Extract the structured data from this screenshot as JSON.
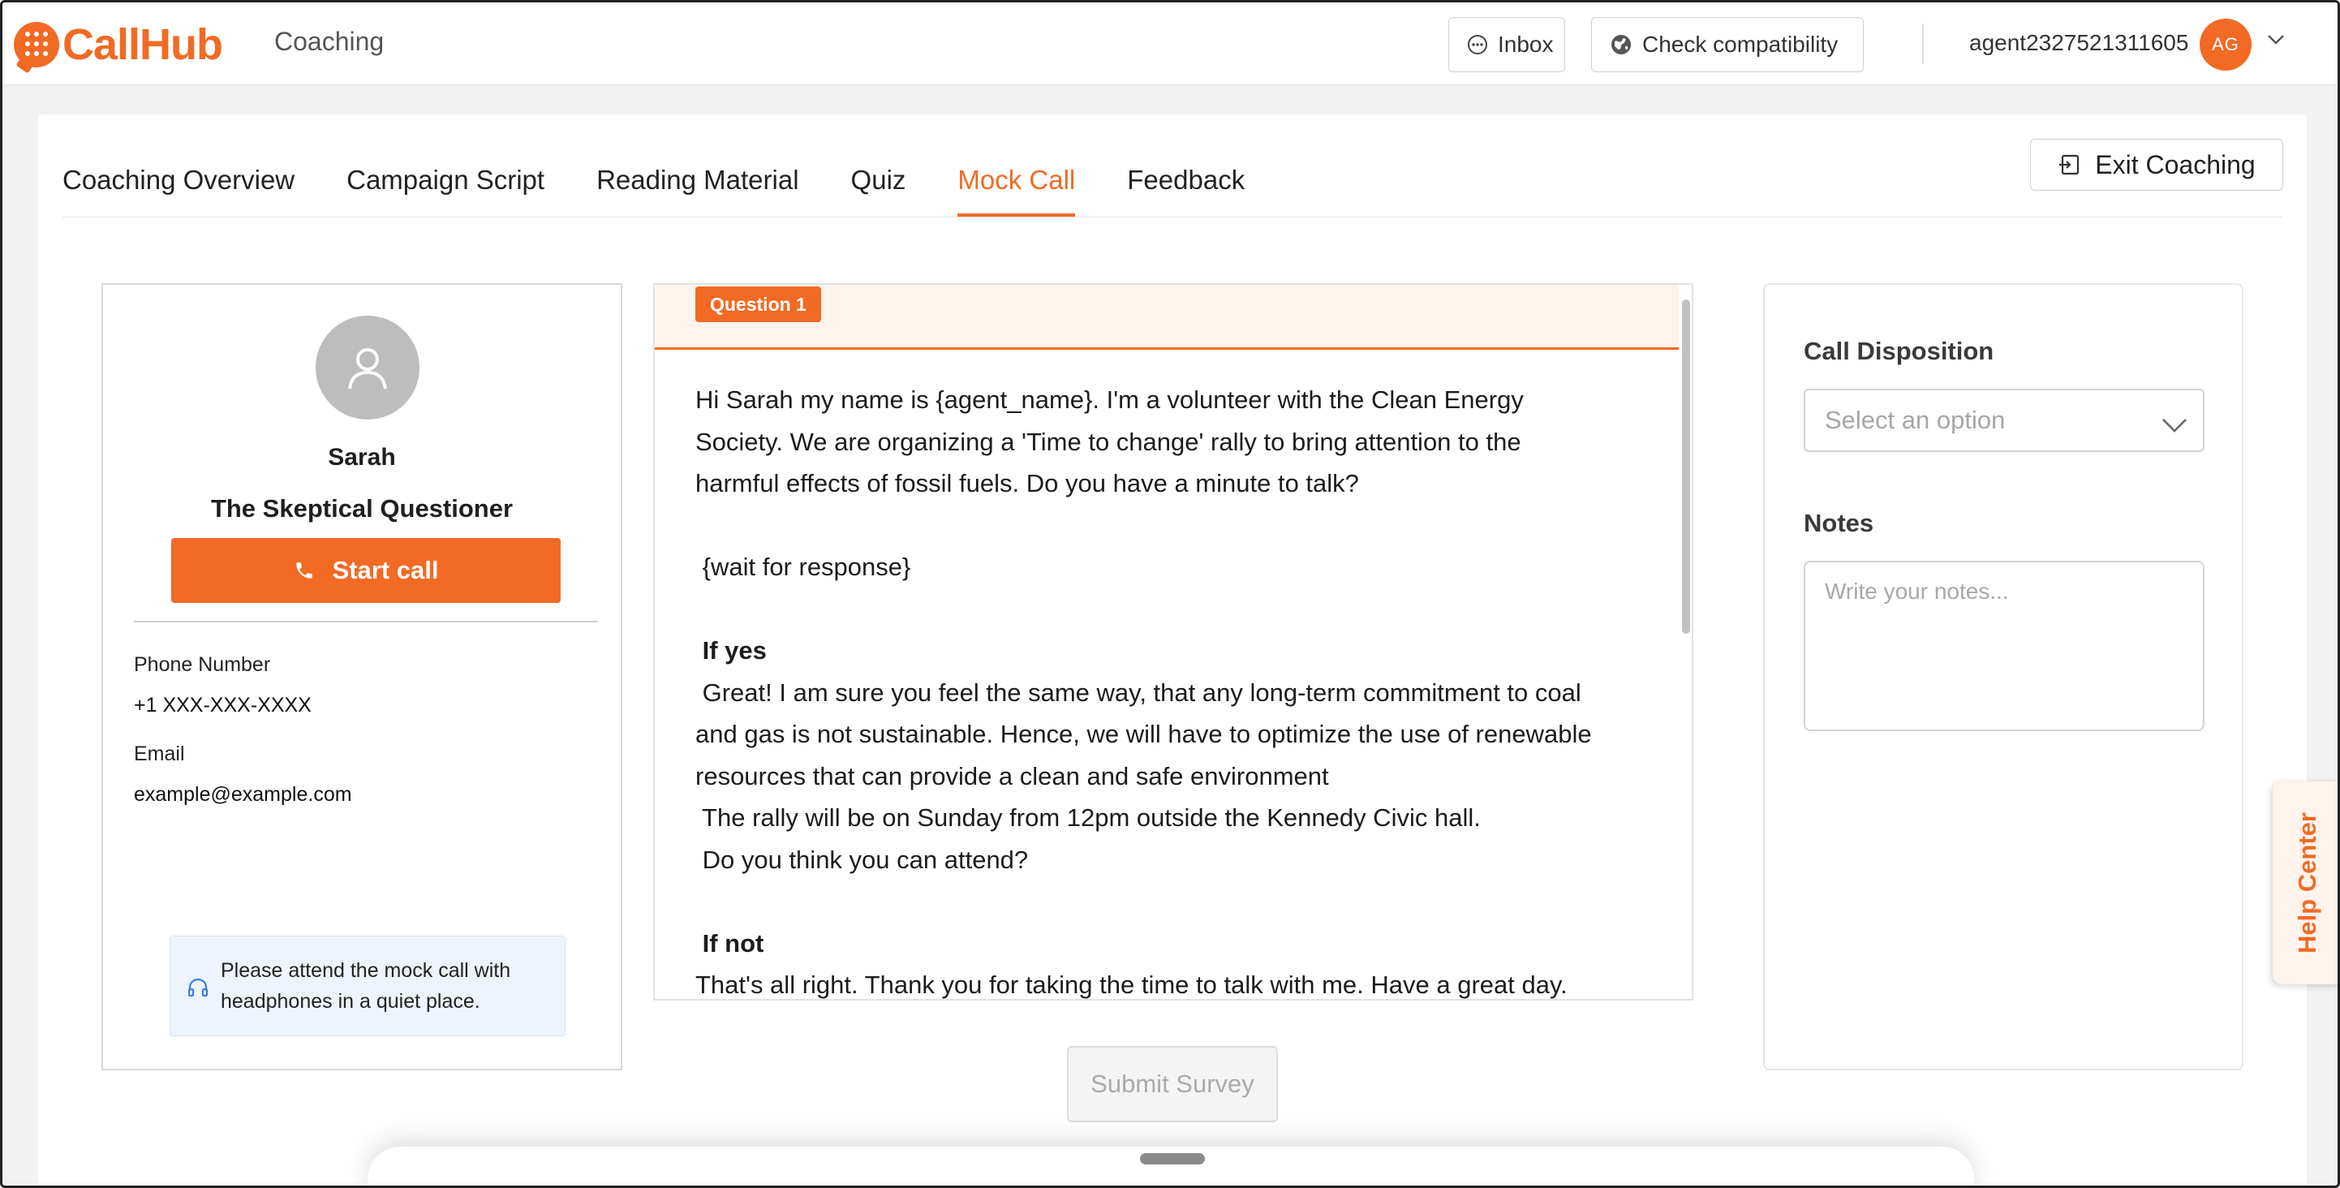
{
  "header": {
    "brand": "CallHub",
    "section": "Coaching",
    "inbox_label": "Inbox",
    "check_compat_label": "Check compatibility",
    "agent_name": "agent2327521311605",
    "avatar_initials": "AG"
  },
  "tabs": [
    {
      "label": "Coaching Overview",
      "active": false
    },
    {
      "label": "Campaign Script",
      "active": false
    },
    {
      "label": "Reading Material",
      "active": false
    },
    {
      "label": "Quiz",
      "active": false
    },
    {
      "label": "Mock Call",
      "active": true
    },
    {
      "label": "Feedback",
      "active": false
    }
  ],
  "exit_label": "Exit Coaching",
  "contact": {
    "name": "Sarah",
    "persona": "The Skeptical Questioner",
    "start_call_label": "Start call",
    "phone_label": "Phone Number",
    "phone_value": "+1 XXX-XXX-XXXX",
    "email_label": "Email",
    "email_value": "example@example.com",
    "tip_line1": "Please attend the mock call with",
    "tip_line2": "headphones in a quiet place."
  },
  "script": {
    "question_badge": "Question 1",
    "lines": {
      "l1": "Hi Sarah my name is {agent_name}. I'm a volunteer with the Clean Energy",
      "l2": "Society. We are organizing a 'Time to change' rally to bring attention to the",
      "l3": "harmful effects of fossil fuels. Do you have a minute to talk?",
      "l4": " {wait for response}",
      "l5": " If yes",
      "l6": " Great! I am sure you feel the same way, that any long-term commitment to coal",
      "l7": "and gas is not sustainable. Hence, we will have to optimize the use of renewable",
      "l8": "resources that can provide a clean and safe environment",
      "l9": " The rally will be on Sunday from 12pm outside the Kennedy Civic hall.",
      "l10": " Do you think you can attend?",
      "l11": " If not",
      "l12": "That's all right. Thank you for taking the time to talk with me. Have a great day."
    }
  },
  "submit_label": "Submit Survey",
  "disposition": {
    "label": "Call Disposition",
    "select_placeholder": "Select an option",
    "notes_label": "Notes",
    "notes_placeholder": "Write your notes..."
  },
  "help_center_label": "Help Center",
  "colors": {
    "accent": "#f26a24",
    "tip_bg": "#edf4fd"
  }
}
